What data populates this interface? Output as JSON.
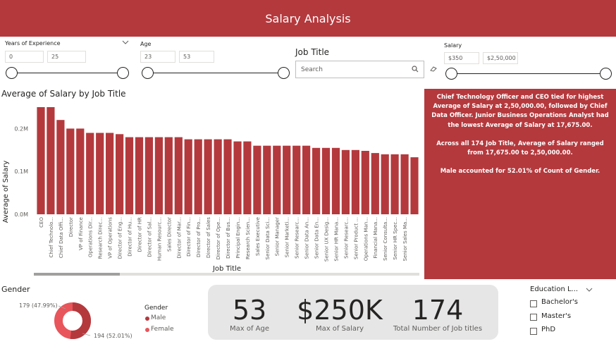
{
  "header": {
    "title": "Salary Analysis"
  },
  "filters": {
    "experience": {
      "label": "Years of Experience",
      "min": "0",
      "max": "25"
    },
    "age": {
      "label": "Age",
      "min": "23",
      "max": "53"
    },
    "job_title": {
      "label": "Job Title",
      "placeholder": "Search"
    },
    "salary": {
      "label": "Salary",
      "min": "$350",
      "max": "$2,50,000"
    }
  },
  "chart_data": {
    "type": "bar",
    "title": "Average of Salary by Job Title",
    "xlabel": "Job Title",
    "ylabel": "Average of Salary",
    "ylim": [
      0,
      250000
    ],
    "yticks": [
      {
        "v": 0,
        "label": "0.0M"
      },
      {
        "v": 100000,
        "label": "0.1M"
      },
      {
        "v": 200000,
        "label": "0.2M"
      }
    ],
    "color": "#b4393d",
    "categories": [
      "CEO",
      "Chief Technolo...",
      "Chief Data Offi...",
      "Director",
      "VP of Finance",
      "Operations Dir...",
      "Research Direc...",
      "VP of Operations",
      "Director of Eng...",
      "Director of Hu...",
      "Director of HR",
      "Director of Sal...",
      "Human Resourc...",
      "Sales Director",
      "Director of Mar...",
      "Director of Fin...",
      "Director of Pro...",
      "Director of Sales",
      "Director of Ope...",
      "Director of Bus...",
      "Principal Engin...",
      "Research Scien...",
      "Sales Executive",
      "Senior Data Sci...",
      "Senior Manager",
      "Senior Marketi...",
      "Senior Researc...",
      "Senior Data An...",
      "Senior Data En...",
      "Senior UX Desig...",
      "Senior HR Mana...",
      "Senior Researc...",
      "Senior Product ...",
      "Operations Man...",
      "Financial Mana...",
      "Senior Consulta...",
      "Senior HR Spec...",
      "Senior Sales Ma..."
    ],
    "values": [
      250000,
      250000,
      220000,
      200000,
      200000,
      190000,
      190000,
      190000,
      187000,
      180000,
      180000,
      180000,
      180000,
      180000,
      180000,
      175000,
      175000,
      175000,
      175000,
      175000,
      170000,
      170000,
      160000,
      160000,
      160000,
      160000,
      160000,
      160000,
      155000,
      155000,
      155000,
      150000,
      150000,
      148000,
      143000,
      140000,
      140000,
      140000,
      133000
    ]
  },
  "insight": {
    "p1": "Chief Technology Officer and CEO tied for highest Average of Salary at 2,50,000.00, followed by Chief Data Officer. Junior Business Operations Analyst had the lowest Average of Salary at 17,675.00.",
    "p2": "Across all 174 Job Title, Average of Salary ranged from 17,675.00 to 2,50,000.00.",
    "p3": "Male accounted for 52.01% of Count of Gender."
  },
  "gender": {
    "title": "Gender",
    "legend_title": "Gender",
    "female_label": "179 (47.99%)",
    "male_label": "194 (52.01%)",
    "male_pct": 52.01,
    "female_pct": 47.99,
    "male_color": "#b4393d",
    "female_color": "#e8555a",
    "legend": [
      "Male",
      "Female"
    ]
  },
  "kpis": [
    {
      "value": "53",
      "label": "Max of Age"
    },
    {
      "value": "$250K",
      "label": "Max of Salary"
    },
    {
      "value": "174",
      "label": "Total Number of Job titles"
    }
  ],
  "education": {
    "title": "Education L...",
    "options": [
      "Bachelor's",
      "Master's",
      "PhD"
    ]
  }
}
